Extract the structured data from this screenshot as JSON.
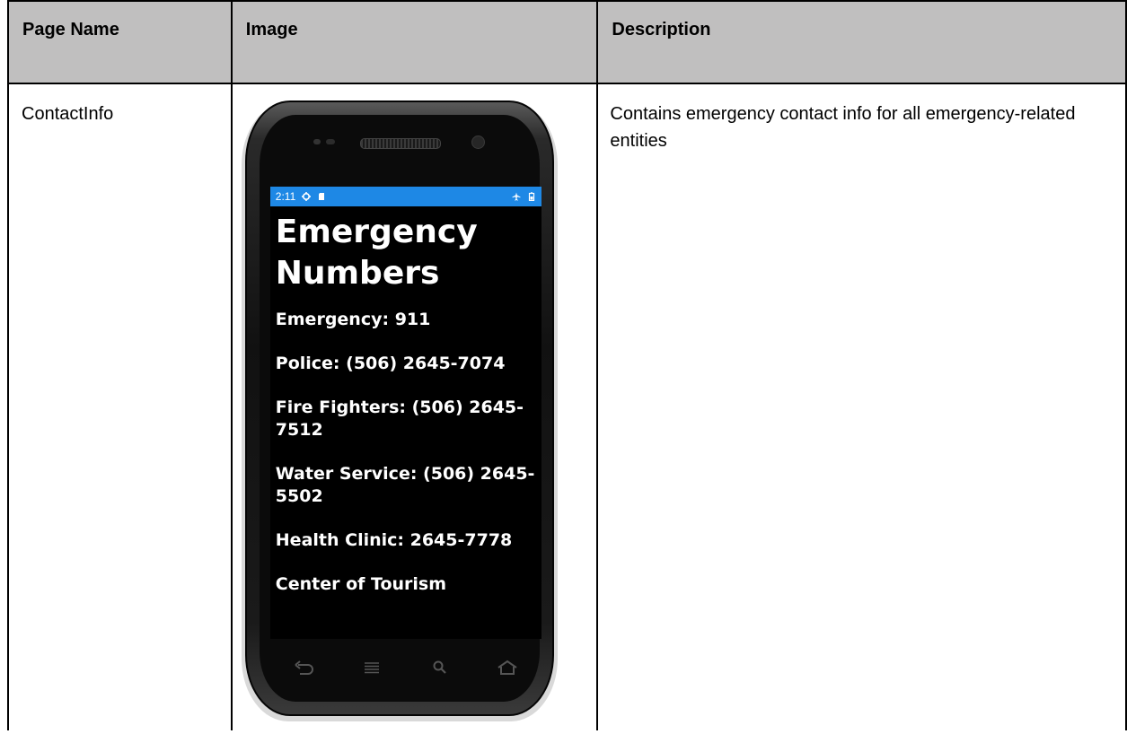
{
  "table": {
    "headers": {
      "col1": "Page Name",
      "col2": "Image",
      "col3": "Description"
    },
    "row": {
      "page_name": "ContactInfo",
      "description": "Contains emergency contact info for all emergency-related entities"
    }
  },
  "phone": {
    "status_time": "2:11",
    "status_icons_left": [
      "gear-icon",
      "sd-card-icon"
    ],
    "status_icons_right": [
      "airplane-icon",
      "battery-icon"
    ],
    "status_color": "#1e88e5",
    "title": "Emergency Numbers",
    "items": [
      "Emergency: 911",
      "Police: (506) 2645-7074",
      "Fire Fighters: (506) 2645-7512",
      "Water Service: (506) 2645-5502",
      "Health Clinic: 2645-7778",
      "Center of Tourism"
    ],
    "nav_icons": [
      "back-icon",
      "menu-icon",
      "search-icon",
      "home-icon"
    ]
  }
}
